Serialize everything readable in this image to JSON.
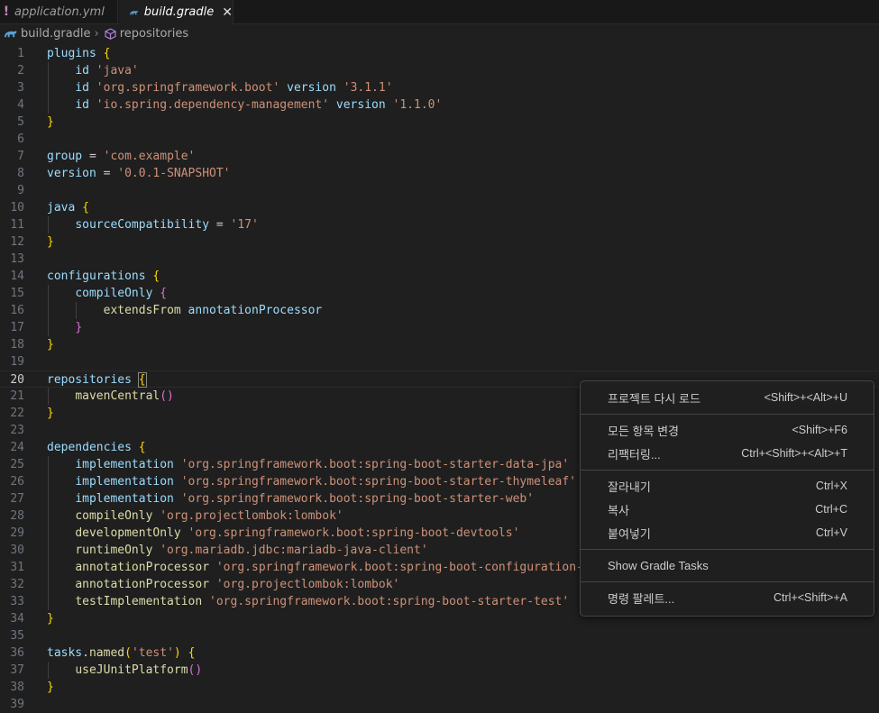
{
  "tabs": [
    {
      "label": "application.yml",
      "icon": "yaml-icon",
      "active": false
    },
    {
      "label": "build.gradle",
      "icon": "gradle-icon",
      "active": true
    }
  ],
  "breadcrumb": {
    "file": "build.gradle",
    "symbol": "repositories"
  },
  "colors": {
    "identifier": "#9cdcfe",
    "function": "#dcdcaa",
    "string": "#ce9178",
    "bracket1": "#ffd700",
    "bracket2": "#da70d6",
    "bracket3": "#179fff"
  },
  "editor": {
    "current_line": 20,
    "lines": [
      {
        "n": 1,
        "tokens": [
          [
            "kw",
            "plugins"
          ],
          [
            "plain",
            " "
          ],
          [
            "b1",
            "{"
          ]
        ]
      },
      {
        "n": 2,
        "tokens": [
          [
            "plain",
            "    "
          ],
          [
            "kw",
            "id"
          ],
          [
            "plain",
            " "
          ],
          [
            "str",
            "'java'"
          ]
        ]
      },
      {
        "n": 3,
        "tokens": [
          [
            "plain",
            "    "
          ],
          [
            "kw",
            "id"
          ],
          [
            "plain",
            " "
          ],
          [
            "str",
            "'org.springframework.boot'"
          ],
          [
            "plain",
            " "
          ],
          [
            "kw",
            "version"
          ],
          [
            "plain",
            " "
          ],
          [
            "str",
            "'3.1.1'"
          ]
        ]
      },
      {
        "n": 4,
        "tokens": [
          [
            "plain",
            "    "
          ],
          [
            "kw",
            "id"
          ],
          [
            "plain",
            " "
          ],
          [
            "str",
            "'io.spring.dependency-management'"
          ],
          [
            "plain",
            " "
          ],
          [
            "kw",
            "version"
          ],
          [
            "plain",
            " "
          ],
          [
            "str",
            "'1.1.0'"
          ]
        ]
      },
      {
        "n": 5,
        "tokens": [
          [
            "b1",
            "}"
          ]
        ]
      },
      {
        "n": 6,
        "tokens": []
      },
      {
        "n": 7,
        "tokens": [
          [
            "kw",
            "group"
          ],
          [
            "plain",
            " = "
          ],
          [
            "str",
            "'com.example'"
          ]
        ]
      },
      {
        "n": 8,
        "tokens": [
          [
            "kw",
            "version"
          ],
          [
            "plain",
            " = "
          ],
          [
            "str",
            "'0.0.1-SNAPSHOT'"
          ]
        ]
      },
      {
        "n": 9,
        "tokens": []
      },
      {
        "n": 10,
        "tokens": [
          [
            "kw",
            "java"
          ],
          [
            "plain",
            " "
          ],
          [
            "b1",
            "{"
          ]
        ]
      },
      {
        "n": 11,
        "tokens": [
          [
            "plain",
            "    "
          ],
          [
            "kw",
            "sourceCompatibility"
          ],
          [
            "plain",
            " = "
          ],
          [
            "str",
            "'17'"
          ]
        ]
      },
      {
        "n": 12,
        "tokens": [
          [
            "b1",
            "}"
          ]
        ]
      },
      {
        "n": 13,
        "tokens": []
      },
      {
        "n": 14,
        "tokens": [
          [
            "kw",
            "configurations"
          ],
          [
            "plain",
            " "
          ],
          [
            "b1",
            "{"
          ]
        ]
      },
      {
        "n": 15,
        "tokens": [
          [
            "plain",
            "    "
          ],
          [
            "kw",
            "compileOnly"
          ],
          [
            "plain",
            " "
          ],
          [
            "b2",
            "{"
          ]
        ]
      },
      {
        "n": 16,
        "tokens": [
          [
            "plain",
            "        "
          ],
          [
            "fn",
            "extendsFrom"
          ],
          [
            "plain",
            " "
          ],
          [
            "kw",
            "annotationProcessor"
          ]
        ]
      },
      {
        "n": 17,
        "tokens": [
          [
            "plain",
            "    "
          ],
          [
            "b2",
            "}"
          ]
        ]
      },
      {
        "n": 18,
        "tokens": [
          [
            "b1",
            "}"
          ]
        ]
      },
      {
        "n": 19,
        "tokens": []
      },
      {
        "n": 20,
        "tokens": [
          [
            "kw",
            "repositories"
          ],
          [
            "plain",
            " "
          ],
          [
            "b1",
            "{"
          ]
        ]
      },
      {
        "n": 21,
        "tokens": [
          [
            "plain",
            "    "
          ],
          [
            "fn",
            "mavenCentral"
          ],
          [
            "b2",
            "()"
          ]
        ]
      },
      {
        "n": 22,
        "tokens": [
          [
            "b1",
            "}"
          ]
        ]
      },
      {
        "n": 23,
        "tokens": []
      },
      {
        "n": 24,
        "tokens": [
          [
            "kw",
            "dependencies"
          ],
          [
            "plain",
            " "
          ],
          [
            "b1",
            "{"
          ]
        ]
      },
      {
        "n": 25,
        "tokens": [
          [
            "plain",
            "    "
          ],
          [
            "kw",
            "implementation"
          ],
          [
            "plain",
            " "
          ],
          [
            "str",
            "'org.springframework.boot:spring-boot-starter-data-jpa'"
          ]
        ]
      },
      {
        "n": 26,
        "tokens": [
          [
            "plain",
            "    "
          ],
          [
            "kw",
            "implementation"
          ],
          [
            "plain",
            " "
          ],
          [
            "str",
            "'org.springframework.boot:spring-boot-starter-thymeleaf'"
          ]
        ]
      },
      {
        "n": 27,
        "tokens": [
          [
            "plain",
            "    "
          ],
          [
            "kw",
            "implementation"
          ],
          [
            "plain",
            " "
          ],
          [
            "str",
            "'org.springframework.boot:spring-boot-starter-web'"
          ]
        ]
      },
      {
        "n": 28,
        "tokens": [
          [
            "plain",
            "    "
          ],
          [
            "fn",
            "compileOnly"
          ],
          [
            "plain",
            " "
          ],
          [
            "str",
            "'org.projectlombok:lombok'"
          ]
        ]
      },
      {
        "n": 29,
        "tokens": [
          [
            "plain",
            "    "
          ],
          [
            "fn",
            "developmentOnly"
          ],
          [
            "plain",
            " "
          ],
          [
            "str",
            "'org.springframework.boot:spring-boot-devtools'"
          ]
        ]
      },
      {
        "n": 30,
        "tokens": [
          [
            "plain",
            "    "
          ],
          [
            "fn",
            "runtimeOnly"
          ],
          [
            "plain",
            " "
          ],
          [
            "str",
            "'org.mariadb.jdbc:mariadb-java-client'"
          ]
        ]
      },
      {
        "n": 31,
        "tokens": [
          [
            "plain",
            "    "
          ],
          [
            "fn",
            "annotationProcessor"
          ],
          [
            "plain",
            " "
          ],
          [
            "str",
            "'org.springframework.boot:spring-boot-configuration-p"
          ]
        ]
      },
      {
        "n": 32,
        "tokens": [
          [
            "plain",
            "    "
          ],
          [
            "fn",
            "annotationProcessor"
          ],
          [
            "plain",
            " "
          ],
          [
            "str",
            "'org.projectlombok:lombok'"
          ]
        ]
      },
      {
        "n": 33,
        "tokens": [
          [
            "plain",
            "    "
          ],
          [
            "fn",
            "testImplementation"
          ],
          [
            "plain",
            " "
          ],
          [
            "str",
            "'org.springframework.boot:spring-boot-starter-test'"
          ]
        ]
      },
      {
        "n": 34,
        "tokens": [
          [
            "b1",
            "}"
          ]
        ]
      },
      {
        "n": 35,
        "tokens": []
      },
      {
        "n": 36,
        "tokens": [
          [
            "kw",
            "tasks"
          ],
          [
            "plain",
            "."
          ],
          [
            "fn",
            "named"
          ],
          [
            "b1",
            "("
          ],
          [
            "str",
            "'test'"
          ],
          [
            "b1",
            ")"
          ],
          [
            "plain",
            " "
          ],
          [
            "b1",
            "{"
          ]
        ]
      },
      {
        "n": 37,
        "tokens": [
          [
            "plain",
            "    "
          ],
          [
            "fn",
            "useJUnitPlatform"
          ],
          [
            "b2",
            "()"
          ]
        ]
      },
      {
        "n": 38,
        "tokens": [
          [
            "b1",
            "}"
          ]
        ]
      },
      {
        "n": 39,
        "tokens": []
      }
    ]
  },
  "context_menu": {
    "groups": [
      [
        {
          "label": "프로젝트 다시 로드",
          "shortcut": "<Shift>+<Alt>+U"
        }
      ],
      [
        {
          "label": "모든 항목 변경",
          "shortcut": "<Shift>+F6"
        },
        {
          "label": "리팩터링...",
          "shortcut": "Ctrl+<Shift>+<Alt>+T"
        }
      ],
      [
        {
          "label": "잘라내기",
          "shortcut": "Ctrl+X"
        },
        {
          "label": "복사",
          "shortcut": "Ctrl+C"
        },
        {
          "label": "붙여넣기",
          "shortcut": "Ctrl+V"
        }
      ],
      [
        {
          "label": "Show Gradle Tasks",
          "shortcut": ""
        }
      ],
      [
        {
          "label": "명령 팔레트...",
          "shortcut": "Ctrl+<Shift>+A"
        }
      ]
    ]
  }
}
